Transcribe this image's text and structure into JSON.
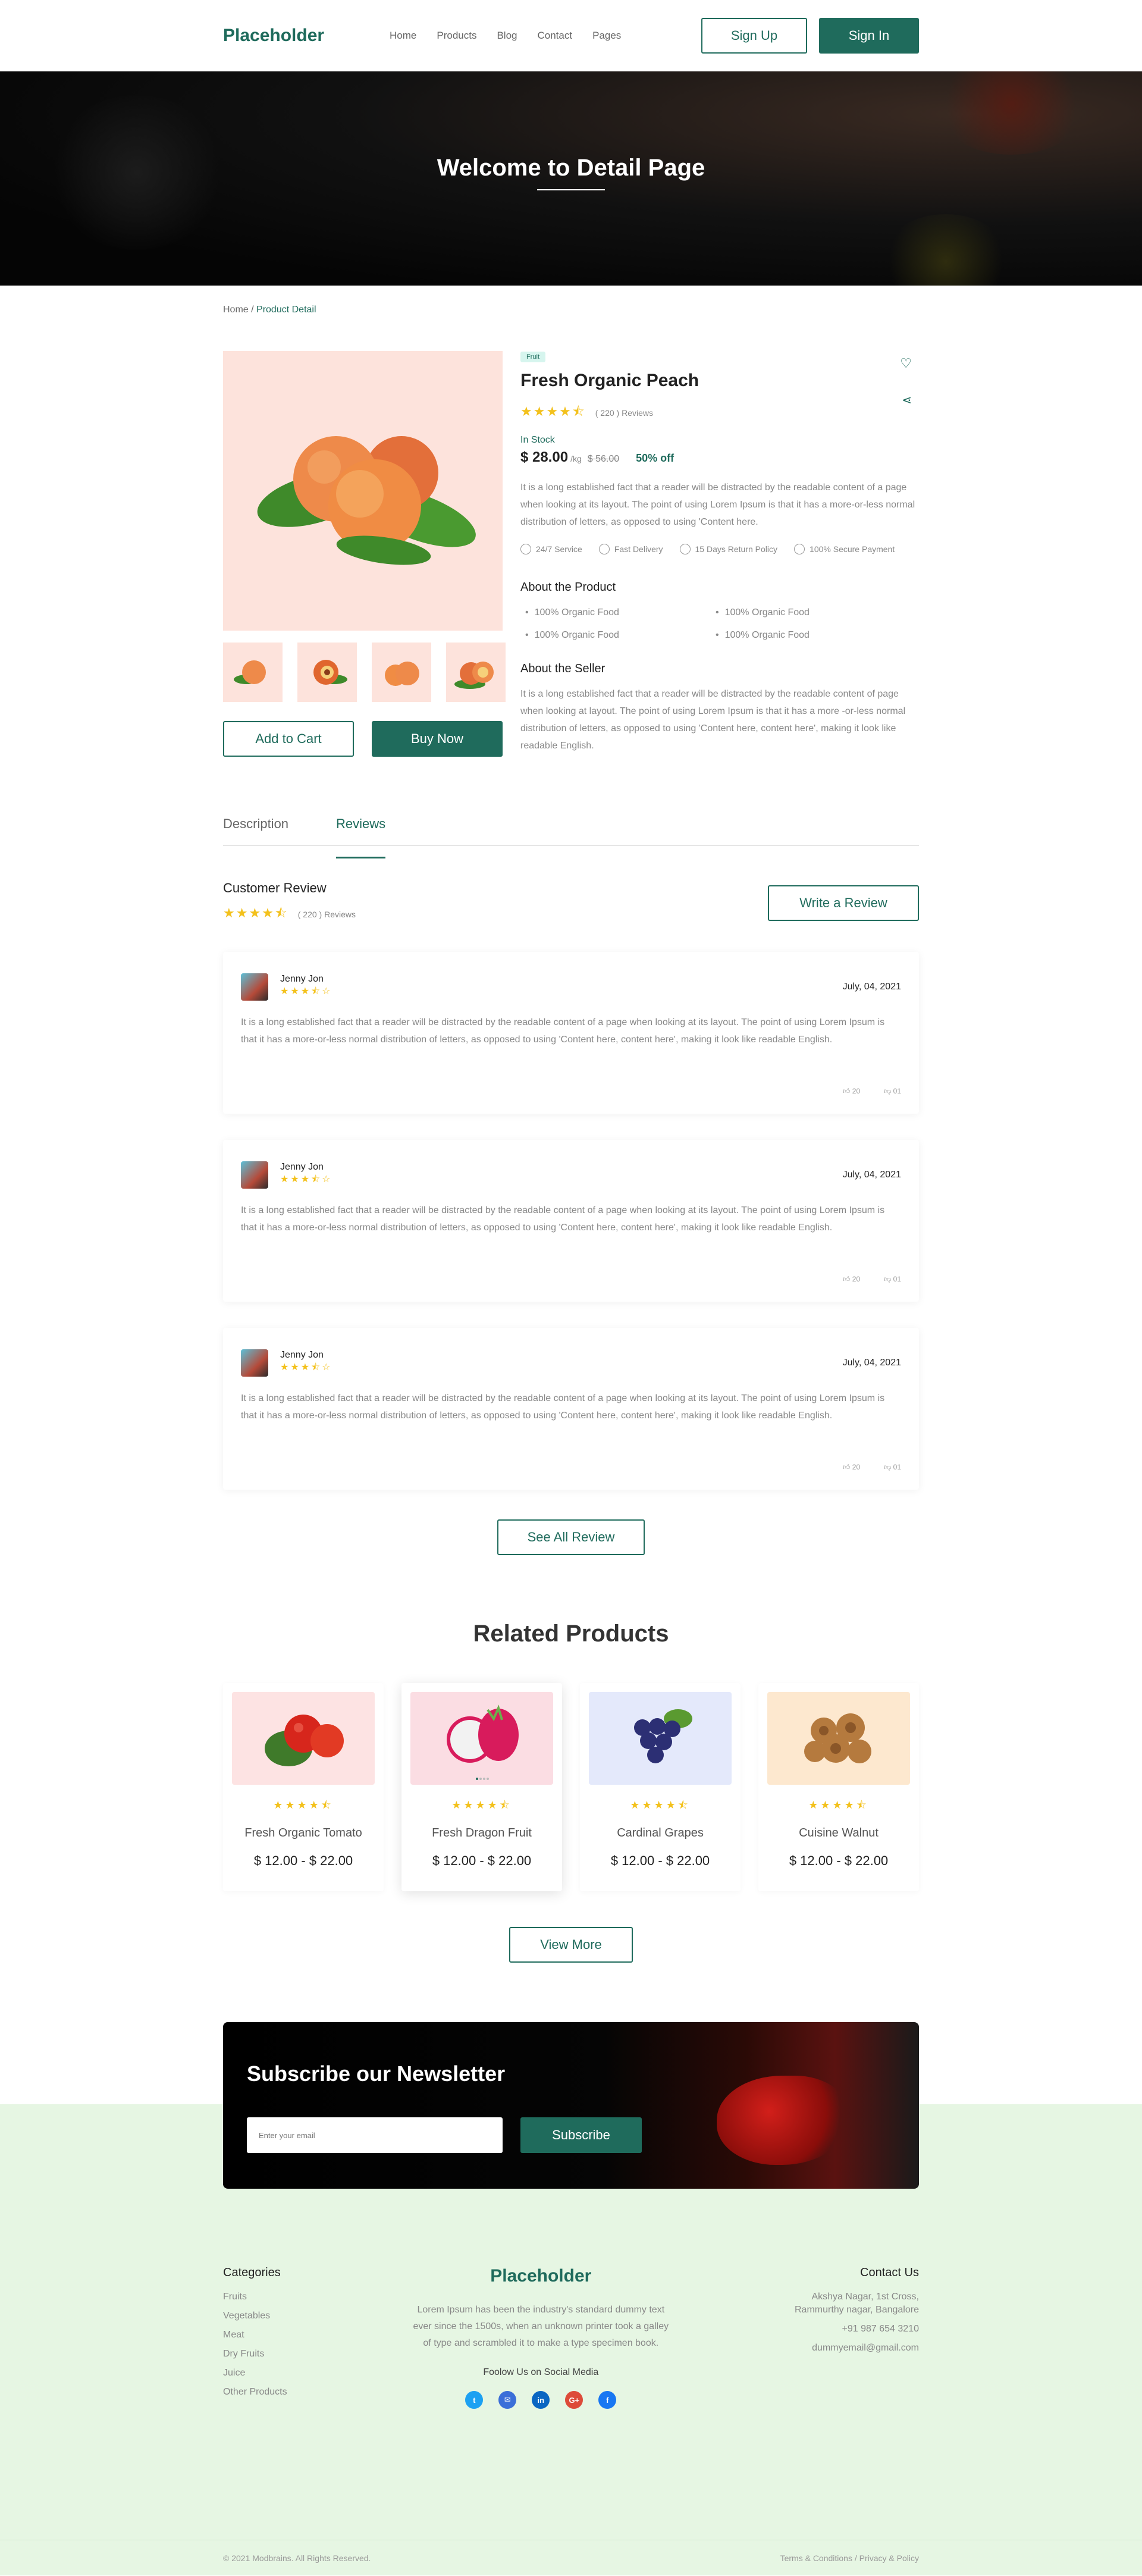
{
  "header": {
    "logo": "Placeholder",
    "nav": [
      "Home",
      "Products",
      "Blog",
      "Contact",
      "Pages"
    ],
    "signup": "Sign Up",
    "signin": "Sign In"
  },
  "hero": {
    "title": "Welcome to Detail Page"
  },
  "breadcrumb": {
    "home": "Home",
    "sep": " / ",
    "current": "Product Detail"
  },
  "product": {
    "badge": "Fruit",
    "title": "Fresh Organic Peach",
    "stars": "★★★★⯪",
    "reviews": "( 220 ) Reviews",
    "stock": "In Stock",
    "price": "$ 28.00",
    "unit": "/kg",
    "old_price": "$ 56.00",
    "discount": "50% off",
    "description": "It is a long established fact that a reader will be distracted by the readable content of a page when looking at its layout. The point of using Lorem Ipsum is that it has a more-or-less normal distribution of letters, as opposed to using 'Content here.",
    "features": [
      "24/7 Service",
      "Fast Delivery",
      "15 Days Return Policy",
      "100% Secure Payment"
    ],
    "about_title": "About the Product",
    "about_items": [
      "100% Organic Food",
      "100% Organic Food",
      "100% Organic Food",
      "100% Organic Food"
    ],
    "seller_title": "About the Seller",
    "seller_text": "It is a long established fact that a reader will be distracted by the readable content of page when looking at layout. The point of using Lorem Ipsum is that it has a more -or-less normal distribution of letters, as opposed to using 'Content here, content here', making it look like readable English.",
    "add_to_cart": "Add to Cart",
    "buy_now": "Buy Now"
  },
  "tabs": [
    "Description",
    "Reviews"
  ],
  "reviews_section": {
    "title": "Customer Review",
    "stars": "★★★★⯪",
    "count": "( 220 ) Reviews",
    "write_btn": "Write a Review",
    "items": [
      {
        "name": "Jenny Jon",
        "stars": "★★★⯪☆",
        "date": "July, 04, 2021",
        "text": "It is a long established fact that a reader will be distracted by the readable content of a page when looking at its layout. The point of using Lorem Ipsum is that it has a more-or-less normal distribution of letters, as opposed to using 'Content here, content here', making it look like readable English.",
        "likes": "20",
        "dislikes": "01"
      },
      {
        "name": "Jenny Jon",
        "stars": "★★★⯪☆",
        "date": "July, 04, 2021",
        "text": "It is a long established fact that a reader will be distracted by the readable content of a page when looking at its layout. The point of using Lorem Ipsum is that it has a more-or-less normal distribution of letters, as opposed to using 'Content here, content here', making it look like readable English.",
        "likes": "20",
        "dislikes": "01"
      },
      {
        "name": "Jenny Jon",
        "stars": "★★★⯪☆",
        "date": "July, 04, 2021",
        "text": "It is a long established fact that a reader will be distracted by the readable content of a page when looking at its layout. The point of using Lorem Ipsum is that it has a more-or-less normal distribution of letters, as opposed to using 'Content here, content here', making it look like readable English.",
        "likes": "20",
        "dislikes": "01"
      }
    ],
    "see_all": "See All Review"
  },
  "related": {
    "title": "Related Products",
    "items": [
      {
        "name": "Fresh Organic Tomato",
        "price": "$ 12.00 - $ 22.00",
        "stars": "★★★★⯪",
        "bg": "#fde3e3"
      },
      {
        "name": "Fresh Dragon Fruit",
        "price": "$ 12.00 - $ 22.00",
        "stars": "★★★★⯪",
        "bg": "#fbdde3"
      },
      {
        "name": "Cardinal Grapes",
        "price": "$ 12.00 - $ 22.00",
        "stars": "★★★★⯪",
        "bg": "#e4e9fb"
      },
      {
        "name": "Cuisine Walnut",
        "price": "$ 12.00 - $ 22.00",
        "stars": "★★★★⯪",
        "bg": "#fde8cf"
      }
    ],
    "view_more": "View More"
  },
  "newsletter": {
    "title": "Subscribe our Newsletter",
    "placeholder": "Enter your email",
    "button": "Subscribe"
  },
  "footer": {
    "categories_title": "Categories",
    "categories": [
      "Fruits",
      "Vegetables",
      "Meat",
      "Dry Fruits",
      "Juice",
      "Other Products"
    ],
    "logo": "Placeholder",
    "description": "Lorem Ipsum has been the industry's standard dummy text ever since the 1500s, when an unknown printer took a galley of type and scrambled it to make a type specimen book.",
    "follow": "Foolow Us on Social Media",
    "contact_title": "Contact Us",
    "address1": "Akshya Nagar, 1st Cross,",
    "address2": "Rammurthy nagar, Bangalore",
    "phone": "+91 987 654 3210",
    "email": "dummyemail@gmail.com",
    "copyright": "© 2021 Modbrains. All Rights Reserved.",
    "legal": "Terms & Conditions / Privacy & Policy"
  },
  "colors": {
    "primary": "#1f6b5c",
    "star": "#f3c11c",
    "footer_bg": "#e6f6e3"
  }
}
